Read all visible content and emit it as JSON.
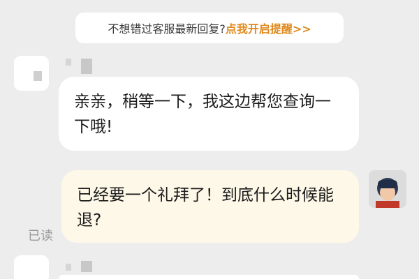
{
  "notice": {
    "text": "不想错过客服最新回复?",
    "link": "点我开启提醒>>"
  },
  "messages": [
    {
      "from": "agent",
      "text": "亲亲，稍等一下，我这边帮您查询一下哦!"
    },
    {
      "from": "user",
      "text": "已经要一个礼拜了！到底什么时候能退?"
    }
  ],
  "read_status": "已读",
  "colors": {
    "background": "#ededed",
    "agent_bubble": "#ffffff",
    "user_bubble": "#fef8e8",
    "link": "#e08a1e"
  },
  "icons": [
    "agent-avatar-blurred",
    "user-avatar"
  ]
}
